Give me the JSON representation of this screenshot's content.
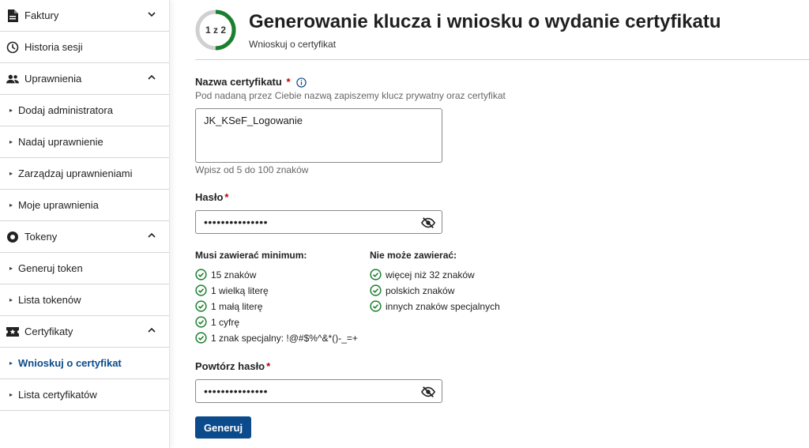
{
  "sidebar": {
    "items": [
      {
        "label": "Faktury",
        "kind": "section",
        "icon": "document-icon",
        "chevron": "down"
      },
      {
        "label": "Historia sesji",
        "kind": "section",
        "icon": "clock-icon"
      },
      {
        "label": "Uprawnienia",
        "kind": "section",
        "icon": "people-icon",
        "chevron": "up"
      },
      {
        "label": "Dodaj administratora",
        "kind": "sub"
      },
      {
        "label": "Nadaj uprawnienie",
        "kind": "sub"
      },
      {
        "label": "Zarządzaj uprawnieniami",
        "kind": "sub"
      },
      {
        "label": "Moje uprawnienia",
        "kind": "sub"
      },
      {
        "label": "Tokeny",
        "kind": "section",
        "icon": "token-icon",
        "chevron": "up"
      },
      {
        "label": "Generuj token",
        "kind": "sub"
      },
      {
        "label": "Lista tokenów",
        "kind": "sub"
      },
      {
        "label": "Certyfikaty",
        "kind": "section",
        "icon": "ticket-icon",
        "chevron": "up"
      },
      {
        "label": "Wnioskuj o certyfikat",
        "kind": "sub",
        "active": true
      },
      {
        "label": "Lista certyfikatów",
        "kind": "sub"
      }
    ]
  },
  "header": {
    "step": "1 z 2",
    "step_progress": 0.5,
    "title": "Generowanie klucza i wniosku o wydanie certyfikatu",
    "subtitle": "Wnioskuj o certyfikat"
  },
  "form": {
    "cert_name": {
      "label": "Nazwa certyfikatu",
      "required_mark": "*",
      "hint": "Pod nadaną przez Ciebie nazwą zapiszemy klucz prywatny oraz certyfikat",
      "value": "JK_KSeF_Logowanie",
      "help": "Wpisz od 5 do 100 znaków"
    },
    "password": {
      "label": "Hasło",
      "required_mark": "*",
      "value": "•••••••••••••••"
    },
    "rules": {
      "must_title": "Musi zawierać minimum:",
      "must": [
        "15 znaków",
        "1 wielką literę",
        "1 małą literę",
        "1 cyfrę",
        "1 znak specjalny: !@#$%^&*()-_=+"
      ],
      "must_not_title": "Nie może zawierać:",
      "must_not": [
        "więcej niż 32 znaków",
        "polskich znaków",
        "innych znaków specjalnych"
      ]
    },
    "repeat_password": {
      "label": "Powtórz hasło",
      "required_mark": "*",
      "value": "•••••••••••••••"
    },
    "submit_label": "Generuj"
  },
  "colors": {
    "accent": "#0b4a8b",
    "success": "#1a7f2e",
    "required": "#c00000",
    "progress": "#1a7f2e"
  }
}
